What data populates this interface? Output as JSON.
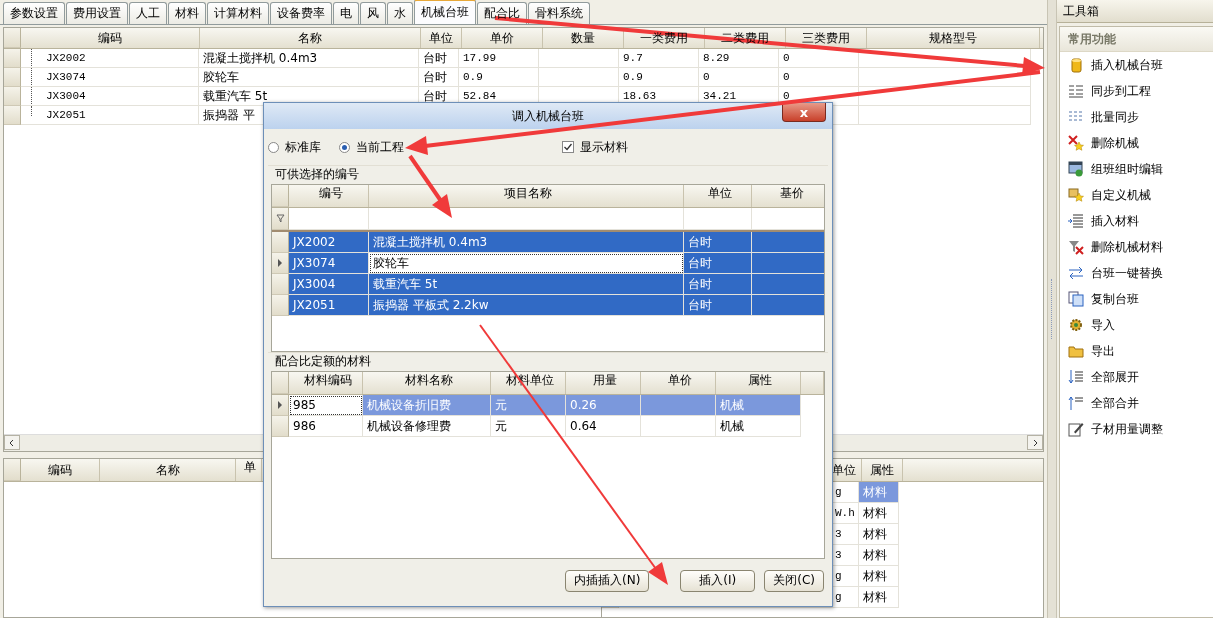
{
  "tabs": [
    {
      "label": "参数设置",
      "selected": false
    },
    {
      "label": "费用设置",
      "selected": false
    },
    {
      "label": "人工",
      "selected": false
    },
    {
      "label": "材料",
      "selected": false
    },
    {
      "label": "计算材料",
      "selected": false
    },
    {
      "label": "设备费率",
      "selected": false
    },
    {
      "label": "电",
      "selected": false
    },
    {
      "label": "风",
      "selected": false
    },
    {
      "label": "水",
      "selected": false
    },
    {
      "label": "机械台班",
      "selected": true
    },
    {
      "label": "配合比",
      "selected": false
    },
    {
      "label": "骨料系统",
      "selected": false
    }
  ],
  "machine_table": {
    "columns": [
      "编码",
      "名称",
      "单位",
      "单价",
      "数量",
      "一类费用",
      "二类费用",
      "三类费用",
      "规格型号"
    ],
    "rows": [
      {
        "code": "JX2002",
        "name": "混凝土搅拌机 0.4m3",
        "unit": "台时",
        "price": "17.99",
        "class1_cost": "9.7",
        "class2_cost": "8.29",
        "class3_cost": "0"
      },
      {
        "code": "JX3074",
        "name": "胶轮车",
        "unit": "台时",
        "price": "0.9",
        "class1_cost": "0.9",
        "class2_cost": "0",
        "class3_cost": "0"
      },
      {
        "code": "JX3004",
        "name": "载重汽车 5t",
        "unit": "台时",
        "price": "52.84",
        "class1_cost": "18.63",
        "class2_cost": "34.21",
        "class3_cost": "0"
      },
      {
        "code": "JX2051",
        "name": "振捣器 平"
      }
    ]
  },
  "material_table_left": {
    "columns": [
      "编码",
      "名称",
      "单"
    ]
  },
  "material_table_right": {
    "columns": [
      "单位",
      "属性"
    ],
    "rows": [
      {
        "unit": "g",
        "attribute": "材料",
        "selected": true
      },
      {
        "unit": "W.h",
        "attribute": "材料",
        "selected": false
      },
      {
        "unit": "3",
        "attribute": "材料",
        "selected": false
      },
      {
        "unit": "3",
        "attribute": "材料",
        "selected": false
      },
      {
        "unit": "g",
        "attribute": "材料",
        "selected": false
      },
      {
        "unit": "g",
        "attribute": "材料",
        "selected": false
      }
    ]
  },
  "dialog": {
    "title": "调入机械台班",
    "close": "x",
    "sources": [
      {
        "label": "标准库",
        "selected": false
      },
      {
        "label": "当前工程",
        "selected": true
      }
    ],
    "show_materials": {
      "label": "显示材料",
      "checked": true
    },
    "available_group": "可供选择的编号",
    "available_table": {
      "columns": [
        "编号",
        "项目名称",
        "单位",
        "基价"
      ],
      "rows": [
        {
          "code": "JX2002",
          "name": "混凝土搅拌机 0.4m3",
          "unit": "台时",
          "selected": true,
          "current": false
        },
        {
          "code": "JX3074",
          "name": "胶轮车",
          "unit": "台时",
          "selected": true,
          "current": true,
          "name_focused": true
        },
        {
          "code": "JX3004",
          "name": "载重汽车 5t",
          "unit": "台时",
          "selected": true,
          "current": false
        },
        {
          "code": "JX2051",
          "name": "振捣器 平板式 2.2kw",
          "unit": "台时",
          "selected": true,
          "current": false
        }
      ]
    },
    "materials_group": "配合比定额的材料",
    "materials_table": {
      "columns": [
        "材料编码",
        "材料名称",
        "材料单位",
        "用量",
        "单价",
        "属性"
      ],
      "rows": [
        {
          "code": "985",
          "name": "机械设备折旧费",
          "unit": "元",
          "amount": "0.26",
          "attribute": "机械",
          "selected": true,
          "current": true,
          "code_focused": true
        },
        {
          "code": "986",
          "name": "机械设备修理费",
          "unit": "元",
          "amount": "0.64",
          "attribute": "机械",
          "selected": false,
          "current": false
        }
      ]
    },
    "buttons": [
      "内插插入(N)",
      "插入(I)",
      "关闭(C)"
    ]
  },
  "toolbox": {
    "title": "工具箱",
    "section": "常用功能",
    "items": [
      "插入机械台班",
      "同步到工程",
      "批量同步",
      "删除机械",
      "组班组时编辑",
      "自定义机械",
      "插入材料",
      "删除机械材料",
      "台班一键替换",
      "复制台班",
      "导入",
      "导出",
      "全部展开",
      "全部合并",
      "子材用量调整"
    ]
  }
}
